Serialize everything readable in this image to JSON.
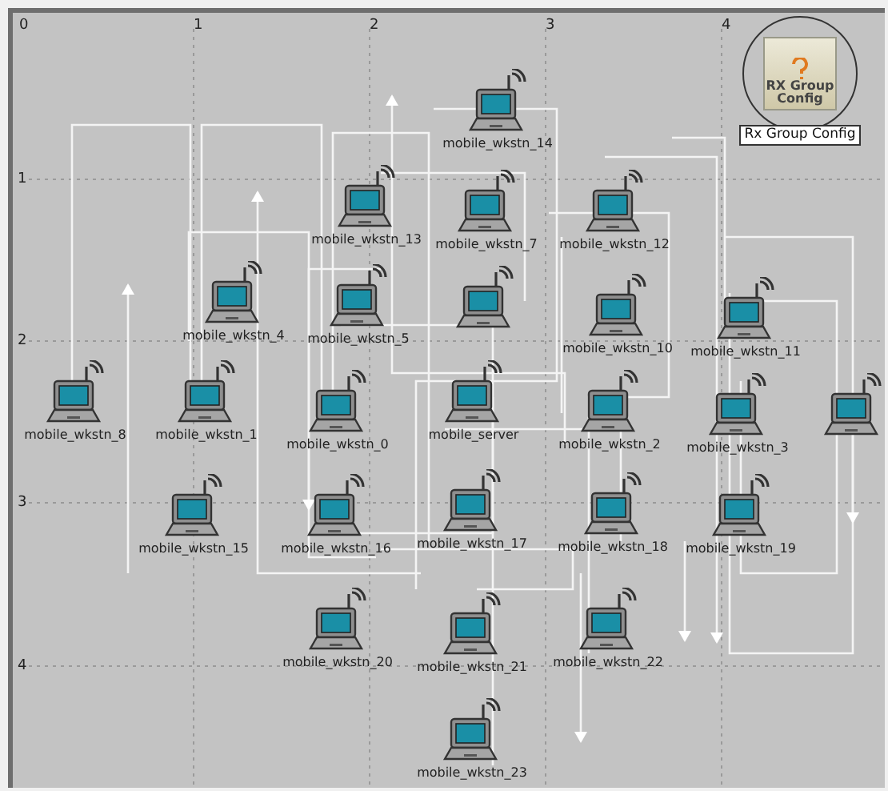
{
  "canvas": {
    "x_ticks": [
      "0",
      "1",
      "2",
      "3",
      "4"
    ],
    "y_ticks": [
      "1",
      "2",
      "3",
      "4"
    ],
    "nodes": [
      {
        "kind": "laptop",
        "label": "mobile_wkstn_14"
      },
      {
        "kind": "laptop",
        "label": "mobile_wkstn_13"
      },
      {
        "kind": "laptop",
        "label": "mobile_wkstn_7"
      },
      {
        "kind": "laptop",
        "label": "mobile_wkstn_12"
      },
      {
        "kind": "laptop",
        "label": "mobile_wkstn_4"
      },
      {
        "kind": "laptop",
        "label": "mobile_wkstn_5"
      },
      {
        "kind": "laptop"
      },
      {
        "kind": "laptop",
        "label": "mobile_wkstn_10"
      },
      {
        "kind": "laptop",
        "label": "mobile_wkstn_11"
      },
      {
        "kind": "laptop",
        "label": "mobile_wkstn_8"
      },
      {
        "kind": "laptop",
        "label": "mobile_wkstn_1"
      },
      {
        "kind": "laptop",
        "label": "mobile_wkstn_0"
      },
      {
        "kind": "laptop",
        "label": "mobile_server"
      },
      {
        "kind": "laptop",
        "label": "mobile_wkstn_2"
      },
      {
        "kind": "laptop",
        "label": "mobile_wkstn_3"
      },
      {
        "kind": "laptop"
      },
      {
        "kind": "laptop",
        "label": "mobile_wkstn_15"
      },
      {
        "kind": "laptop",
        "label": "mobile_wkstn_16"
      },
      {
        "kind": "laptop",
        "label": "mobile_wkstn_17"
      },
      {
        "kind": "laptop",
        "label": "mobile_wkstn_18"
      },
      {
        "kind": "laptop",
        "label": "mobile_wkstn_19"
      },
      {
        "kind": "laptop",
        "label": "mobile_wkstn_20"
      },
      {
        "kind": "laptop",
        "label": "mobile_wkstn_21"
      },
      {
        "kind": "laptop",
        "label": "mobile_wkstn_22"
      },
      {
        "kind": "laptop",
        "label": "mobile_wkstn_23"
      },
      {
        "kind": "config",
        "icon_text": "RX Group Config",
        "label": "Rx Group Config"
      }
    ]
  }
}
